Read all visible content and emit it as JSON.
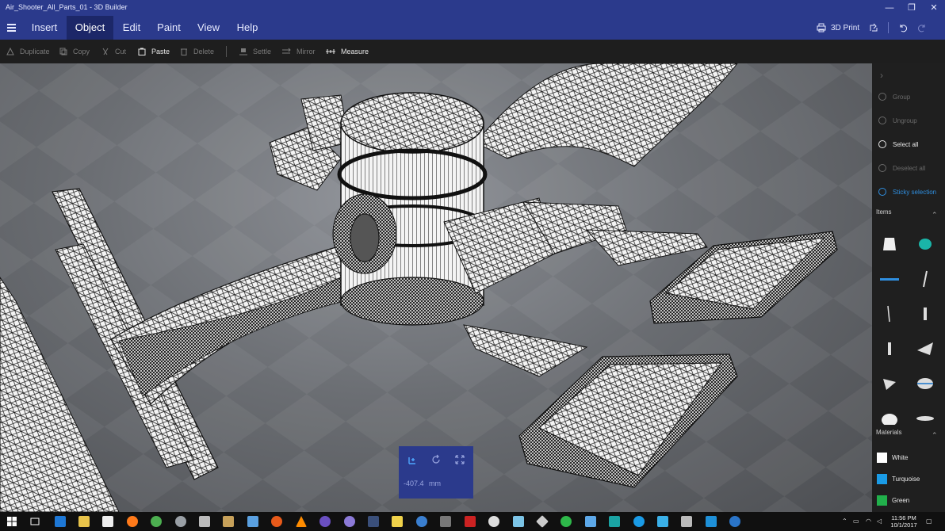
{
  "window": {
    "title": "Air_Shooter_All_Parts_01 - 3D Builder",
    "minimize": "—",
    "restore": "❐",
    "close": "✕"
  },
  "menu": {
    "tabs": [
      "Insert",
      "Object",
      "Edit",
      "Paint",
      "View",
      "Help"
    ],
    "active": "Object",
    "print_label": "3D Print"
  },
  "toolbar": {
    "items": [
      {
        "label": "Duplicate",
        "enabled": false
      },
      {
        "label": "Copy",
        "enabled": false
      },
      {
        "label": "Cut",
        "enabled": false
      },
      {
        "label": "Paste",
        "enabled": true
      },
      {
        "label": "Delete",
        "enabled": false
      },
      {
        "label": "Settle",
        "enabled": false
      },
      {
        "label": "Mirror",
        "enabled": false
      },
      {
        "label": "Measure",
        "enabled": true
      }
    ]
  },
  "transform_panel": {
    "value": "-407.4",
    "unit": "mm"
  },
  "side_panel": {
    "actions": [
      {
        "label": "Group",
        "state": "disabled"
      },
      {
        "label": "Ungroup",
        "state": "disabled"
      },
      {
        "label": "Select all",
        "state": "enabled"
      },
      {
        "label": "Deselect all",
        "state": "disabled"
      },
      {
        "label": "Sticky selection",
        "state": "accent"
      }
    ],
    "items_header": "Items",
    "materials_header": "Materials",
    "materials": [
      {
        "name": "White",
        "color": "#ffffff"
      },
      {
        "name": "Turquoise",
        "color": "#1a9be6"
      },
      {
        "name": "Green",
        "color": "#21b04b"
      }
    ]
  },
  "taskbar": {
    "time": "11:56 PM",
    "date": "10/1/2017"
  },
  "colors": {
    "accent": "#2b3a8c",
    "accent_dark": "#1c2768",
    "highlight": "#2f8fe0"
  }
}
